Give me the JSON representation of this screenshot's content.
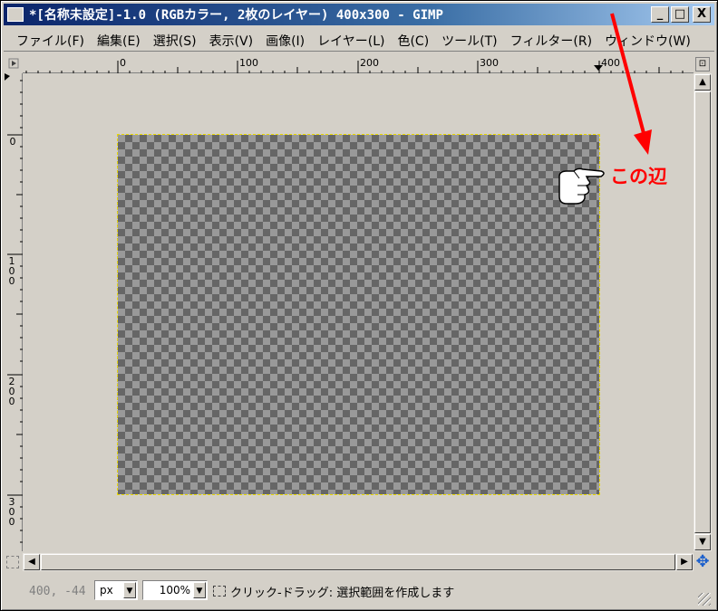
{
  "window": {
    "title": "*[名称未設定]-1.0 (RGBカラー, 2枚のレイヤー) 400x300 - GIMP",
    "minimize": "_",
    "maximize": "□",
    "close": "X"
  },
  "menu": [
    "ファイル(F)",
    "編集(E)",
    "選択(S)",
    "表示(V)",
    "画像(I)",
    "レイヤー(L)",
    "色(C)",
    "ツール(T)",
    "フィルター(R)",
    "ウィンドウ(W)"
  ],
  "ruler": {
    "horizontal_labels": [
      "0",
      "100",
      "200",
      "300",
      "400"
    ],
    "vertical_labels": [
      "0",
      "100",
      "200",
      "300"
    ]
  },
  "status": {
    "coords": "400, -44",
    "unit": "px",
    "zoom": "100%",
    "message": "クリック-ドラッグ: 選択範囲を作成します"
  },
  "annotation": {
    "label": "この辺",
    "color": "#ff0000"
  },
  "icons": [
    "app-icon",
    "ruler-corner-icon",
    "zoom-corner-icon",
    "quick-mask-icon",
    "navigate-icon",
    "hand-pointer-icon"
  ]
}
